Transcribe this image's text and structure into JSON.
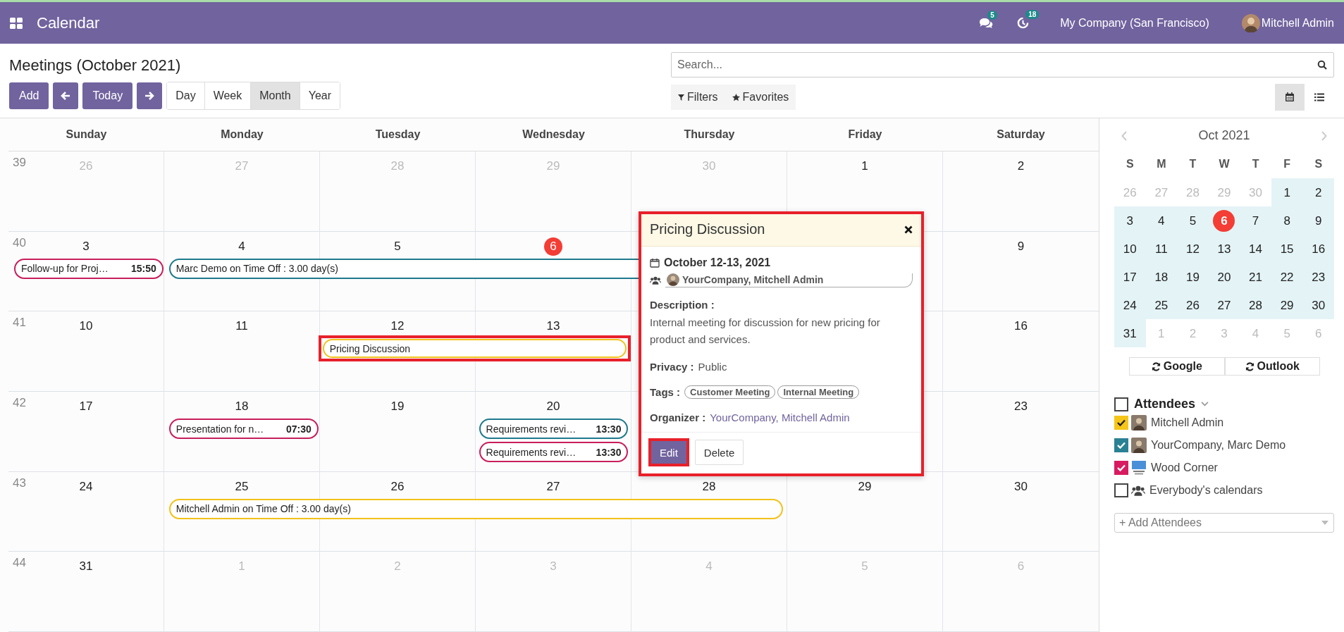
{
  "topbar": {
    "app_title": "Calendar",
    "messages_count": "5",
    "activities_count": "18",
    "company": "My Company (San Francisco)",
    "user": "Mitchell Admin"
  },
  "control_panel": {
    "title": "Meetings (October 2021)",
    "add_button": "Add",
    "today_button": "Today",
    "scales": [
      {
        "label": "Day",
        "selected": false
      },
      {
        "label": "Week",
        "selected": false
      },
      {
        "label": "Month",
        "selected": true
      },
      {
        "label": "Year",
        "selected": false
      }
    ],
    "search": {
      "placeholder": "Search..."
    },
    "filters": "Filters",
    "favorites": "Favorites",
    "views": [
      {
        "kind": "calendar",
        "selected": true
      },
      {
        "kind": "list",
        "selected": false
      }
    ]
  },
  "calendar": {
    "weekdays": [
      "Sunday",
      "Monday",
      "Tuesday",
      "Wednesday",
      "Thursday",
      "Friday",
      "Saturday"
    ],
    "weeks": [
      {
        "number": "39",
        "days": [
          {
            "label": "26",
            "muted": true,
            "today": false
          },
          {
            "label": "27",
            "muted": true,
            "today": false
          },
          {
            "label": "28",
            "muted": true,
            "today": false
          },
          {
            "label": "29",
            "muted": true,
            "today": false
          },
          {
            "label": "30",
            "muted": true,
            "today": false
          },
          {
            "label": "1",
            "muted": false,
            "today": false
          },
          {
            "label": "2",
            "muted": false,
            "today": false
          }
        ]
      },
      {
        "number": "40",
        "days": [
          {
            "label": "3",
            "muted": false,
            "today": false
          },
          {
            "label": "4",
            "muted": false,
            "today": false
          },
          {
            "label": "5",
            "muted": false,
            "today": false
          },
          {
            "label": "6",
            "muted": false,
            "today": true
          },
          {
            "label": "9",
            "muted": false,
            "today": false
          }
        ],
        "events": [
          {
            "title": "Follow-up for Proj…",
            "time": "15:50",
            "color": "#c81e5b",
            "highlighted": false
          },
          {
            "title": "Marc Demo on Time Off : 3.00 day(s)",
            "color": "#1f7a8c",
            "highlighted": false
          }
        ]
      },
      {
        "number": "41",
        "days": [
          {
            "label": "10",
            "muted": false,
            "today": false
          },
          {
            "label": "11",
            "muted": false,
            "today": false
          },
          {
            "label": "12",
            "muted": false,
            "today": false
          },
          {
            "label": "13",
            "muted": false,
            "today": false
          },
          {
            "label": "16",
            "muted": false,
            "today": false
          }
        ],
        "events": [
          {
            "title": "Pricing Discussion",
            "color": "#f2c218",
            "highlighted": true
          }
        ]
      },
      {
        "number": "42",
        "days": [
          {
            "label": "17",
            "muted": false,
            "today": false
          },
          {
            "label": "18",
            "muted": false,
            "today": false
          },
          {
            "label": "19",
            "muted": false,
            "today": false
          },
          {
            "label": "20",
            "muted": false,
            "today": false
          },
          {
            "label": "23",
            "muted": false,
            "today": false
          }
        ],
        "events": [
          {
            "title": "Presentation for n…",
            "time": "07:30",
            "color": "#c81e5b",
            "highlighted": false
          },
          {
            "title": "Requirements revi…",
            "time": "13:30",
            "color": "#1f7a8c",
            "highlighted": false
          },
          {
            "title": "Requirements revi…",
            "time": "13:30",
            "color": "#c81e5b",
            "highlighted": false
          }
        ]
      },
      {
        "number": "43",
        "days": [
          {
            "label": "24",
            "muted": false,
            "today": false
          },
          {
            "label": "25",
            "muted": false,
            "today": false
          },
          {
            "label": "26",
            "muted": false,
            "today": false
          },
          {
            "label": "27",
            "muted": false,
            "today": false
          },
          {
            "label": "28",
            "muted": false,
            "today": false
          },
          {
            "label": "29",
            "muted": false,
            "today": false
          },
          {
            "label": "30",
            "muted": false,
            "today": false
          }
        ],
        "events": [
          {
            "title": "Mitchell Admin on Time Off : 3.00 day(s)",
            "color": "#f2c218",
            "highlighted": false
          }
        ]
      },
      {
        "number": "44",
        "days": [
          {
            "label": "31",
            "muted": false,
            "today": false
          },
          {
            "label": "1",
            "muted": true,
            "today": false
          },
          {
            "label": "2",
            "muted": true,
            "today": false
          },
          {
            "label": "3",
            "muted": true,
            "today": false
          },
          {
            "label": "4",
            "muted": true,
            "today": false
          },
          {
            "label": "5",
            "muted": true,
            "today": false
          },
          {
            "label": "6",
            "muted": true,
            "today": false
          }
        ]
      }
    ]
  },
  "popup": {
    "title": "Pricing Discussion",
    "highlighted": true,
    "date": "October 12-13, 2021",
    "attendees": "YourCompany, Mitchell Admin",
    "description_label": "Description :",
    "description": "Internal meeting for discussion for new pricing for product and services.",
    "privacy_label": "Privacy :",
    "privacy": "Public",
    "tags_label": "Tags :",
    "tags": [
      "Customer Meeting",
      "Internal Meeting"
    ],
    "organizer_label": "Organizer :",
    "organizer": "YourCompany, Mitchell Admin",
    "edit_button": {
      "label": "Edit",
      "highlighted": true
    },
    "delete_button": "Delete"
  },
  "sidebar": {
    "month": "Oct 2021",
    "weekday_letters": [
      "S",
      "M",
      "T",
      "W",
      "T",
      "F",
      "S"
    ],
    "weeks": [
      [
        {
          "label": "26",
          "muted": true,
          "today": false
        },
        {
          "label": "27",
          "muted": true,
          "today": false
        },
        {
          "label": "28",
          "muted": true,
          "today": false
        },
        {
          "label": "29",
          "muted": true,
          "today": false
        },
        {
          "label": "30",
          "muted": true,
          "today": false
        },
        {
          "label": "1",
          "muted": false,
          "today": false
        },
        {
          "label": "2",
          "muted": false,
          "today": false
        }
      ],
      [
        {
          "label": "3",
          "muted": false,
          "today": false
        },
        {
          "label": "4",
          "muted": false,
          "today": false
        },
        {
          "label": "5",
          "muted": false,
          "today": false
        },
        {
          "label": "6",
          "muted": false,
          "today": true
        },
        {
          "label": "7",
          "muted": false,
          "today": false
        },
        {
          "label": "8",
          "muted": false,
          "today": false
        },
        {
          "label": "9",
          "muted": false,
          "today": false
        }
      ],
      [
        {
          "label": "10",
          "muted": false,
          "today": false
        },
        {
          "label": "11",
          "muted": false,
          "today": false
        },
        {
          "label": "12",
          "muted": false,
          "today": false
        },
        {
          "label": "13",
          "muted": false,
          "today": false
        },
        {
          "label": "14",
          "muted": false,
          "today": false
        },
        {
          "label": "15",
          "muted": false,
          "today": false
        },
        {
          "label": "16",
          "muted": false,
          "today": false
        }
      ],
      [
        {
          "label": "17",
          "muted": false,
          "today": false
        },
        {
          "label": "18",
          "muted": false,
          "today": false
        },
        {
          "label": "19",
          "muted": false,
          "today": false
        },
        {
          "label": "20",
          "muted": false,
          "today": false
        },
        {
          "label": "21",
          "muted": false,
          "today": false
        },
        {
          "label": "22",
          "muted": false,
          "today": false
        },
        {
          "label": "23",
          "muted": false,
          "today": false
        }
      ],
      [
        {
          "label": "24",
          "muted": false,
          "today": false
        },
        {
          "label": "25",
          "muted": false,
          "today": false
        },
        {
          "label": "26",
          "muted": false,
          "today": false
        },
        {
          "label": "27",
          "muted": false,
          "today": false
        },
        {
          "label": "28",
          "muted": false,
          "today": false
        },
        {
          "label": "29",
          "muted": false,
          "today": false
        },
        {
          "label": "30",
          "muted": false,
          "today": false
        }
      ],
      [
        {
          "label": "31",
          "muted": false,
          "today": false
        },
        {
          "label": "1",
          "muted": true,
          "today": false
        },
        {
          "label": "2",
          "muted": true,
          "today": false
        },
        {
          "label": "3",
          "muted": true,
          "today": false
        },
        {
          "label": "4",
          "muted": true,
          "today": false
        },
        {
          "label": "5",
          "muted": true,
          "today": false
        },
        {
          "label": "6",
          "muted": true,
          "today": false
        }
      ]
    ],
    "sync_buttons": [
      "Google",
      "Outlook"
    ],
    "attendees_header": {
      "label": "Attendees",
      "checked": false
    },
    "attendees": [
      {
        "name": "Mitchell Admin",
        "checked": true,
        "color": "#f5c518",
        "kind": "person"
      },
      {
        "name": "YourCompany, Marc Demo",
        "checked": true,
        "color": "#2a8193",
        "kind": "person"
      },
      {
        "name": "Wood Corner",
        "checked": true,
        "color": "#d81b60",
        "kind": "logo"
      },
      {
        "name": "Everybody's calendars",
        "checked": false,
        "kind": "group"
      }
    ],
    "add_attendees": {
      "placeholder": "+ Add Attendees"
    }
  }
}
